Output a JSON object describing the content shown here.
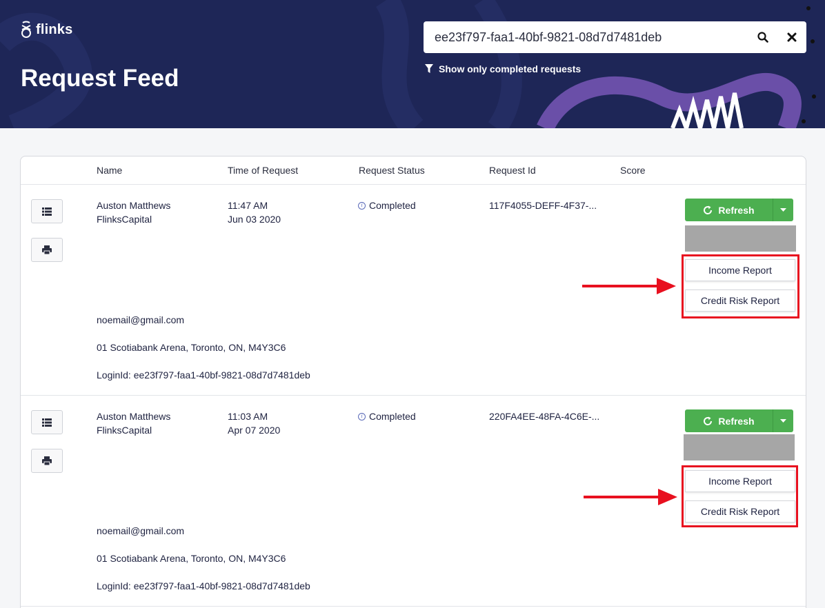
{
  "header": {
    "brand": "flinks",
    "title": "Request Feed",
    "search_value": "ee23f797-faa1-40bf-9821-08d7d7481deb",
    "filter_label": "Show only completed requests"
  },
  "table": {
    "columns": [
      "Name",
      "Time of Request",
      "Request Status",
      "Request Id",
      "Score"
    ],
    "rows": [
      {
        "name": "Auston Matthews",
        "institution": "FlinksCapital",
        "time": "11:47 AM",
        "date": "Jun 03 2020",
        "status": "Completed",
        "request_id": "117F4055-DEFF-4F37-...",
        "refresh_label": "Refresh",
        "menu": [
          "Income Report",
          "Credit Risk Report"
        ],
        "email": "noemail@gmail.com",
        "address": "01 Scotiabank Arena, Toronto, ON, M4Y3C6",
        "login_id": "LoginId: ee23f797-faa1-40bf-9821-08d7d7481deb"
      },
      {
        "name": "Auston Matthews",
        "institution": "FlinksCapital",
        "time": "11:03 AM",
        "date": "Apr 07 2020",
        "status": "Completed",
        "request_id": "220FA4EE-48FA-4C6E-...",
        "refresh_label": "Refresh",
        "menu": [
          "Income Report",
          "Credit Risk Report"
        ],
        "email": "noemail@gmail.com",
        "address": "01 Scotiabank Arena, Toronto, ON, M4Y3C6",
        "login_id": "LoginId: ee23f797-faa1-40bf-9821-08d7d7481deb"
      }
    ]
  },
  "colors": {
    "header_bg": "#1e2657",
    "accent_purple": "#6a4fa8",
    "refresh_green": "#4caf50",
    "annotation_red": "#e8101f"
  },
  "icons": [
    "flinks-logo-icon",
    "search-icon",
    "close-icon",
    "filter-icon",
    "list-icon",
    "print-icon",
    "refresh-icon",
    "caret-down-icon",
    "info-icon",
    "arrow-right-icon"
  ]
}
